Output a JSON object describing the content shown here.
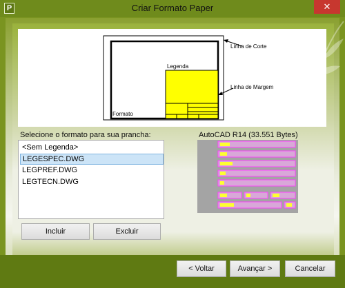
{
  "window": {
    "title": "Criar Formato Paper",
    "app_icon_glyph": "P",
    "close_glyph": "✕"
  },
  "preview": {
    "legenda_label": "Legenda",
    "formato_label": "Formato",
    "corte_label": "Linha de Corte",
    "margem_label": "Linha de Margem"
  },
  "format_select": {
    "label": "Selecione o formato para sua prancha:",
    "items": [
      "<Sem Legenda>",
      "LEGESPEC.DWG",
      "LEGPREF.DWG",
      "LEGTECN.DWG"
    ],
    "selected": "LEGESPEC.DWG"
  },
  "dwg_info": {
    "label": "AutoCAD R14 (33.551 Bytes)"
  },
  "buttons": {
    "incluir": "Incluir",
    "excluir": "Excluir",
    "voltar": "< Voltar",
    "avancar": "Avançar >",
    "cancelar": "Cancelar"
  },
  "colors": {
    "titlebar": "#6f8b1c",
    "close": "#c7372f",
    "legenda_fill": "#ffff00",
    "selection": "#cce4f7"
  }
}
